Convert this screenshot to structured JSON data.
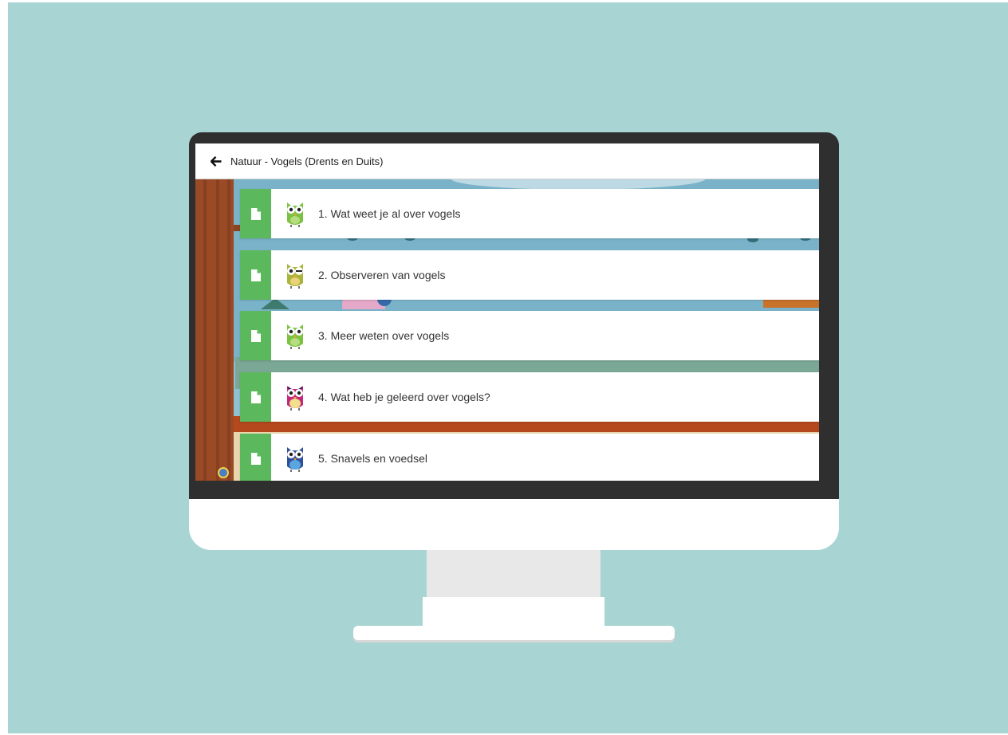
{
  "header": {
    "back_icon": "arrow-left-icon",
    "title": "Natuur - Vogels (Drents en Duits)"
  },
  "lessons": [
    {
      "label": "1. Wat weet je al over vogels",
      "icon": "document-icon",
      "owl": "owl-green-icon",
      "owl_color": "#7cc242"
    },
    {
      "label": "2. Observeren van vogels",
      "icon": "document-icon",
      "owl": "owl-olive-icon",
      "owl_color": "#a9b53a"
    },
    {
      "label": "3. Meer weten over vogels",
      "icon": "document-icon",
      "owl": "owl-green-icon",
      "owl_color": "#7cc242"
    },
    {
      "label": "4. Wat heb je geleerd over vogels?",
      "icon": "document-icon",
      "owl": "owl-pink-icon",
      "owl_color": "#c2297a"
    },
    {
      "label": "5. Snavels en voedsel",
      "icon": "document-icon",
      "owl": "owl-blue-icon",
      "owl_color": "#3a7cc9"
    }
  ],
  "colors": {
    "background": "#a8d5d3",
    "lesson_accent": "#5cb85c",
    "monitor_bezel": "#2f2f2f"
  }
}
